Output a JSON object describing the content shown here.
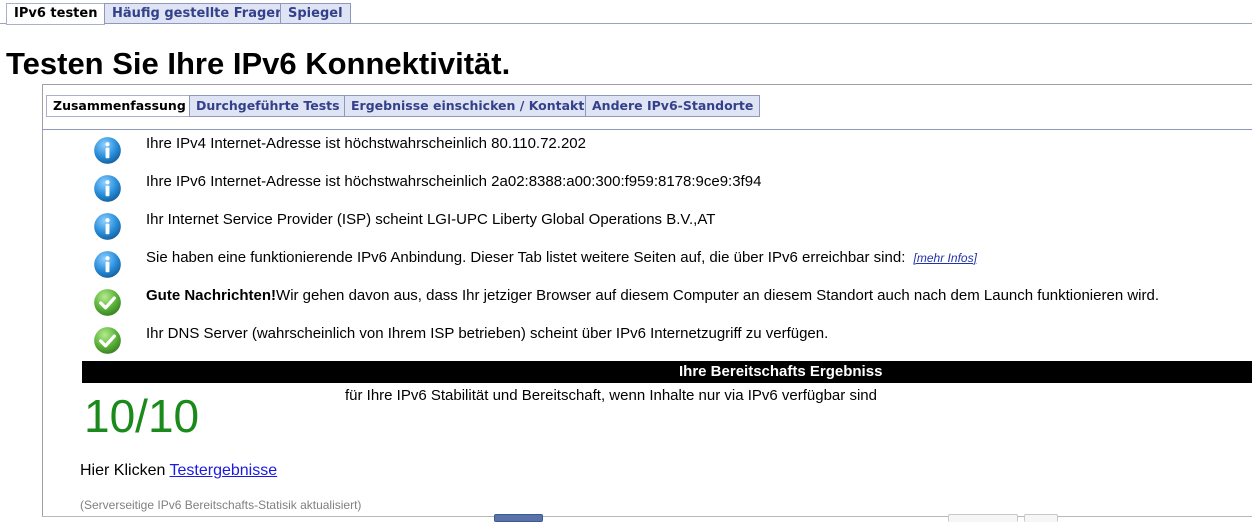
{
  "top_tabs": [
    {
      "label": "IPv6 testen",
      "active": true
    },
    {
      "label": "Häufig gestellte Fragen",
      "active": false
    },
    {
      "label": "Spiegel",
      "active": false
    }
  ],
  "page_title": "Testen Sie Ihre IPv6 Konnektivität.",
  "inner_tabs": [
    {
      "label": "Zusammenfassung",
      "active": true
    },
    {
      "label": "Durchgeführte Tests",
      "active": false
    },
    {
      "label": "Ergebnisse einschicken / Kontakt",
      "active": false
    },
    {
      "label": "Andere IPv6-Standorte",
      "active": false
    }
  ],
  "messages": [
    {
      "icon": "info-icon",
      "text": "Ihre IPv4 Internet-Adresse ist höchstwahrscheinlich 80.110.72.202"
    },
    {
      "icon": "info-icon",
      "text": "Ihre IPv6 Internet-Adresse ist höchstwahrscheinlich 2a02:8388:a00:300:f959:8178:9ce9:3f94"
    },
    {
      "icon": "info-icon",
      "text": "Ihr Internet Service Provider (ISP) scheint LGI-UPC Liberty Global Operations B.V.,AT"
    },
    {
      "icon": "info-icon",
      "text": "Sie haben eine funktionierende IPv6 Anbindung. Dieser Tab listet weitere Seiten auf, die über IPv6 erreichbar sind:",
      "link": "[mehr Infos]"
    },
    {
      "icon": "check-icon",
      "bold": "Gute Nachrichten!",
      "text": "Wir gehen davon aus, dass Ihr jetziger Browser auf diesem Computer an diesem Standort auch nach dem Launch funktionieren wird."
    },
    {
      "icon": "check-icon",
      "text": "Ihr DNS Server (wahrscheinlich von Ihrem ISP betrieben) scheint über IPv6 Internetzugriff zu verfügen."
    }
  ],
  "score_section": {
    "title": "Ihre Bereitschafts Ergebniss",
    "score": "10/10",
    "description": "für Ihre IPv6 Stabilität und Bereitschaft, wenn Inhalte nur via IPv6 verfügbar sind"
  },
  "click_line": {
    "prefix": "Hier Klicken",
    "link": "Testergebnisse"
  },
  "footnote": "(Serverseitige IPv6 Bereitschafts-Statisik aktualisiert)",
  "colors": {
    "tab_bg": "#dfe4f4",
    "tab_text": "#34418a",
    "score_green": "#1a8a1a",
    "info_blue": "#1b7fcf",
    "check_green": "#4caf2a"
  }
}
